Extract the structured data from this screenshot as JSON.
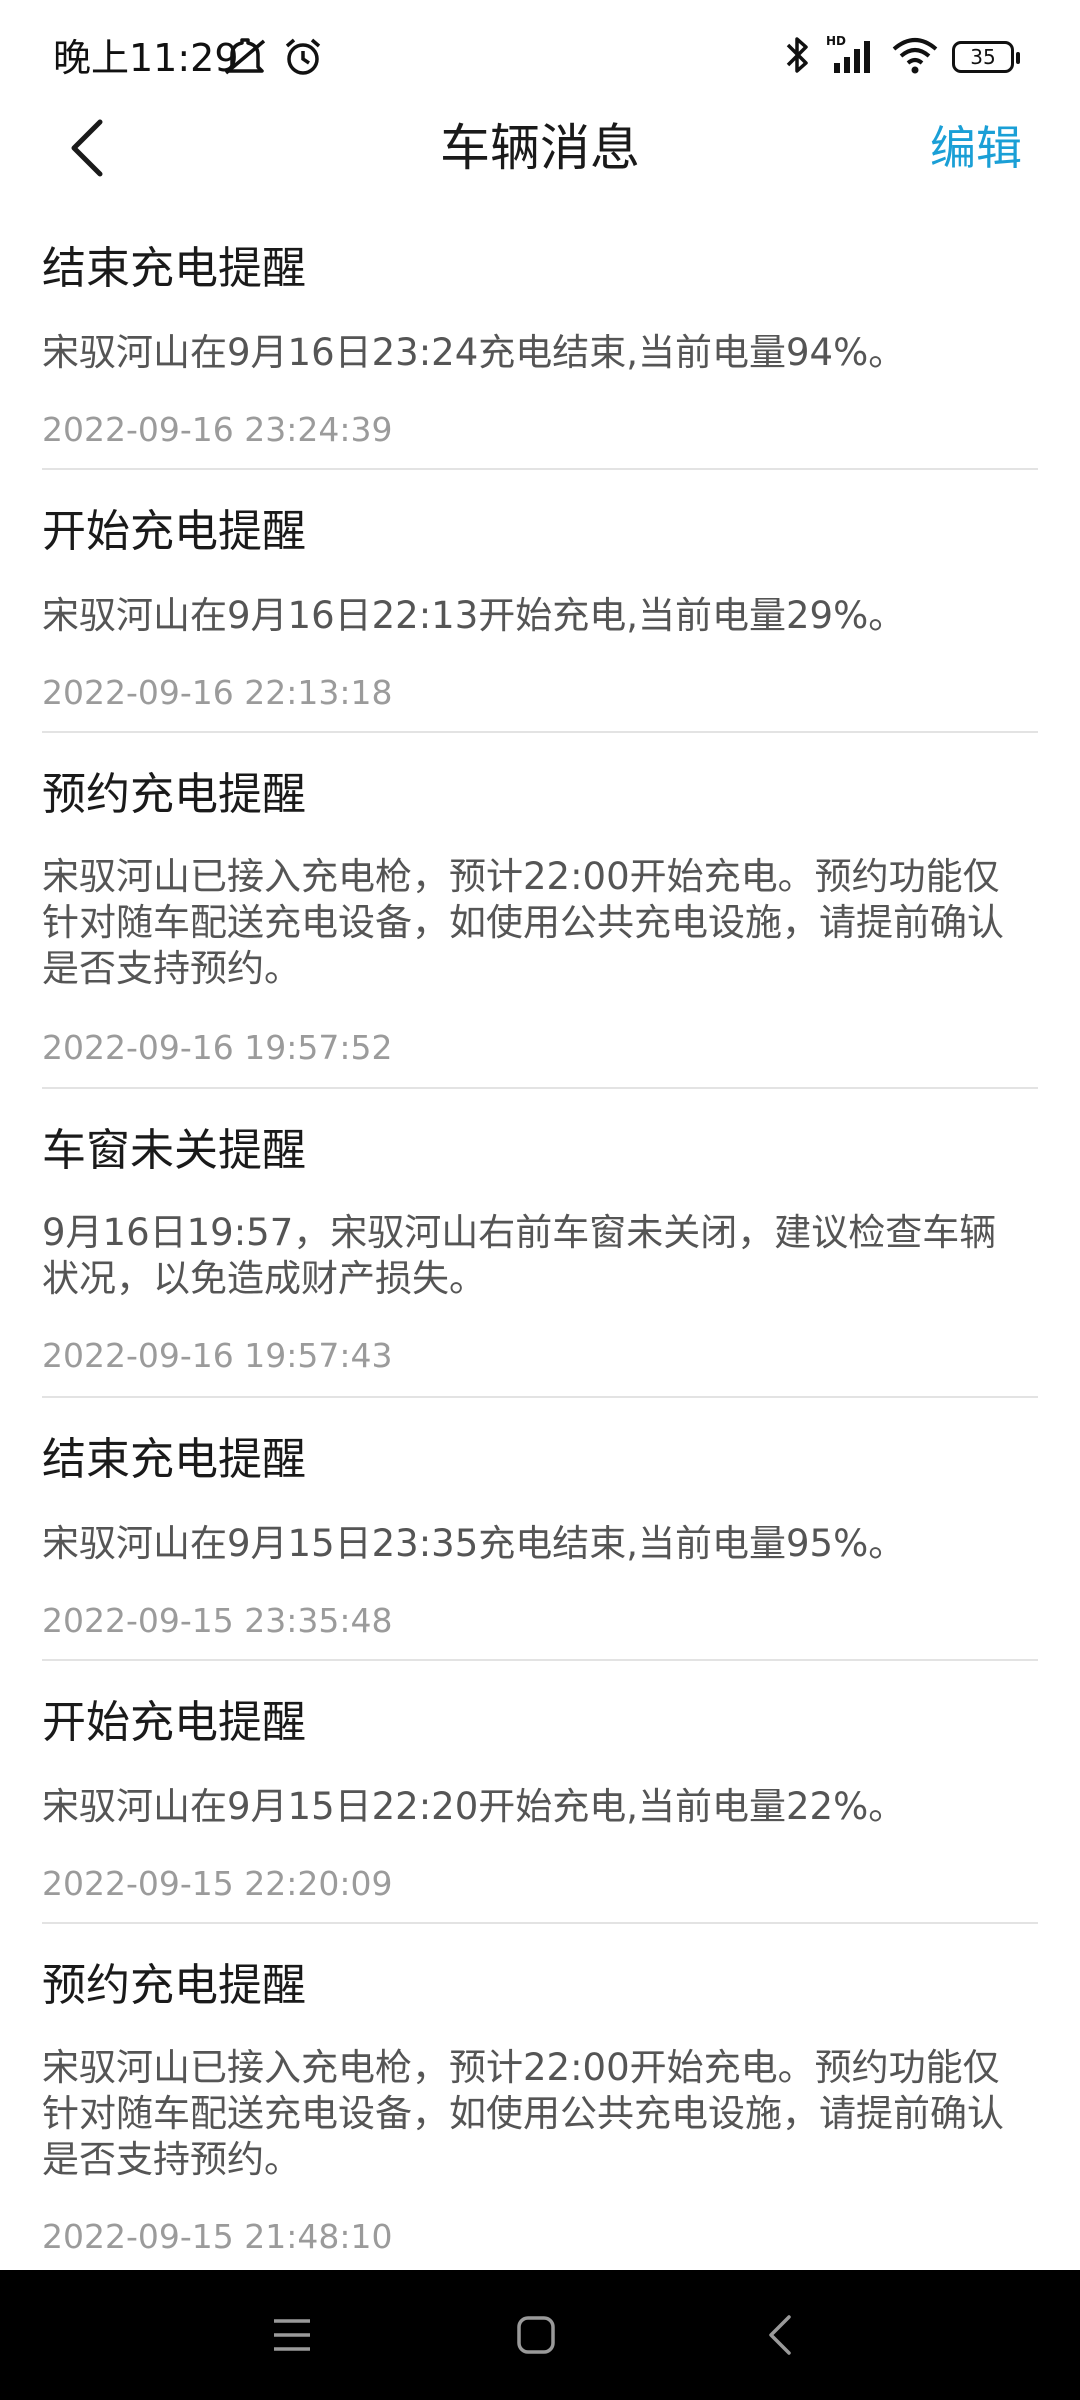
{
  "status_bar": {
    "time": "晚上11:29",
    "left_icons": [
      "mute-icon",
      "alarm-icon"
    ],
    "right_icons": [
      "bluetooth-icon",
      "hd-signal-icon",
      "wifi-icon"
    ],
    "battery": "35"
  },
  "header": {
    "title": "车辆消息",
    "edit_label": "编辑"
  },
  "messages": [
    {
      "title": "结束充电提醒",
      "body": "宋驭河山在9月16日23:24充电结束,当前电量94%。",
      "time": "2022-09-16 23:24:39"
    },
    {
      "title": "开始充电提醒",
      "body": "宋驭河山在9月16日22:13开始充电,当前电量29%。",
      "time": "2022-09-16 22:13:18"
    },
    {
      "title": "预约充电提醒",
      "body": "宋驭河山已接入充电枪，预计22:00开始充电。预约功能仅针对随车配送充电设备，如使用公共充电设施，请提前确认是否支持预约。",
      "time": "2022-09-16 19:57:52"
    },
    {
      "title": "车窗未关提醒",
      "body": "9月16日19:57，宋驭河山右前车窗未关闭，建议检查车辆状况，以免造成财产损失。",
      "time": "2022-09-16 19:57:43"
    },
    {
      "title": "结束充电提醒",
      "body": "宋驭河山在9月15日23:35充电结束,当前电量95%。",
      "time": "2022-09-15 23:35:48"
    },
    {
      "title": "开始充电提醒",
      "body": "宋驭河山在9月15日22:20开始充电,当前电量22%。",
      "time": "2022-09-15 22:20:09"
    },
    {
      "title": "预约充电提醒",
      "body": "宋驭河山已接入充电枪，预计22:00开始充电。预约功能仅针对随车配送充电设备，如使用公共充电设施，请提前确认是否支持预约。",
      "time": "2022-09-15 21:48:10"
    }
  ],
  "nav_bar": {
    "icons": [
      "menu-icon",
      "home-icon",
      "back-icon"
    ]
  },
  "colors": {
    "accent": "#1a9fd6",
    "title_text": "#1a1a1a",
    "body_text": "#555555",
    "time_text": "#9b9b9b",
    "divider": "#e3e3e3"
  }
}
